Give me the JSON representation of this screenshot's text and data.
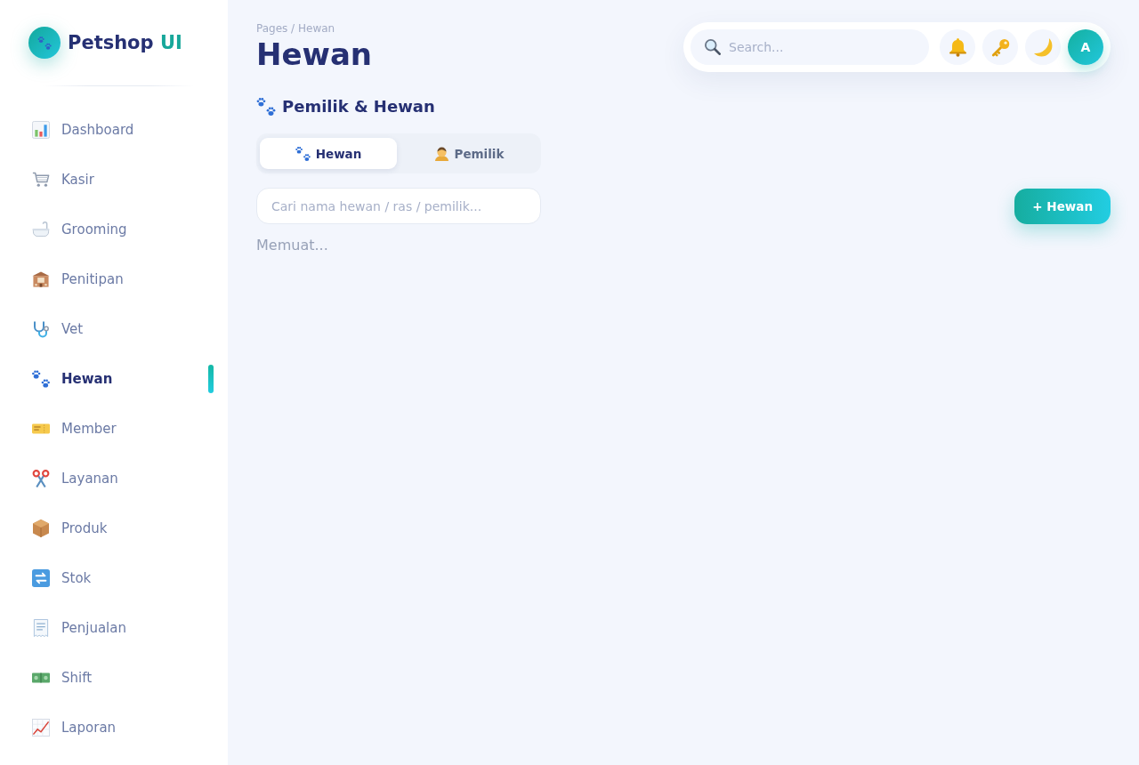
{
  "sidebar": {
    "brand": {
      "name": "Petshop",
      "accent": "UI"
    },
    "items": [
      {
        "label": "Dashboard",
        "selected": false
      },
      {
        "label": "Kasir",
        "selected": false
      },
      {
        "label": "Grooming",
        "selected": false
      },
      {
        "label": "Penitipan",
        "selected": false
      },
      {
        "label": "Vet",
        "selected": false
      },
      {
        "label": "Hewan",
        "selected": true
      },
      {
        "label": "Member",
        "selected": false
      },
      {
        "label": "Layanan",
        "selected": false
      },
      {
        "label": "Produk",
        "selected": false
      },
      {
        "label": "Stok",
        "selected": false
      },
      {
        "label": "Penjualan",
        "selected": false
      },
      {
        "label": "Shift",
        "selected": false
      },
      {
        "label": "Laporan",
        "selected": false
      }
    ]
  },
  "header": {
    "breadcrumb": "Pages / Hewan",
    "title": "Hewan"
  },
  "topbar": {
    "search": {
      "placeholder": "Search..."
    },
    "avatar": "A"
  },
  "section": {
    "title": "Pemilik & Hewan",
    "tabs": [
      {
        "label": "Hewan",
        "selected": true
      },
      {
        "label": "Pemilik",
        "selected": false
      }
    ],
    "search": {
      "placeholder": "Cari nama hewan / ras / pemilik..."
    },
    "add_button": "+ Hewan",
    "status": "Memuat..."
  }
}
